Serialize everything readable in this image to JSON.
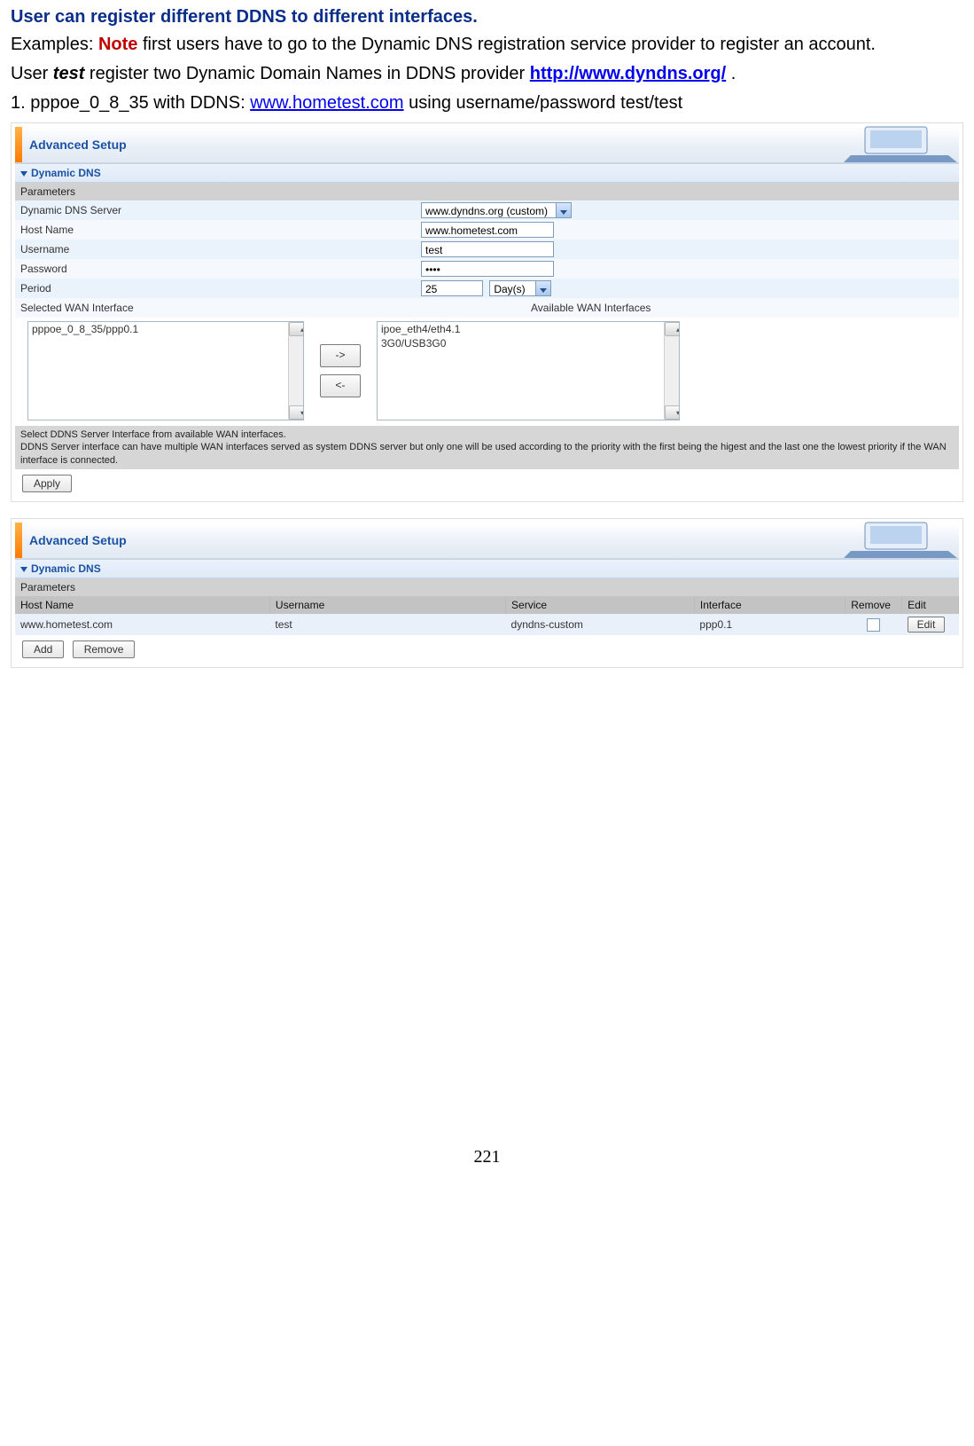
{
  "doc": {
    "heading": "User can register different DDNS to different interfaces.",
    "examples_prefix": "Examples: ",
    "note_label": "Note",
    "examples_rest": " first users have to go to the Dynamic DNS registration service provider to register an account.",
    "line3a": "User ",
    "line3_user": "test",
    "line3b": " register two Dynamic Domain Names in DDNS provider ",
    "provider_url_text": "http://www.dyndns.org/",
    "line3c": " .",
    "line4a": "1. pppoe_0_8_35 with DDNS: ",
    "ddns_link_text": "www.hometest.com",
    "line4b": " using username/password test/test",
    "page_number": "221"
  },
  "shot1": {
    "header_title": "Advanced Setup",
    "section_title": "Dynamic DNS",
    "params_label": "Parameters",
    "rows": {
      "ddns_server_label": "Dynamic DNS Server",
      "ddns_server_value": "www.dyndns.org (custom)",
      "hostname_label": "Host Name",
      "hostname_value": "www.hometest.com",
      "username_label": "Username",
      "username_value": "test",
      "password_label": "Password",
      "password_value": "••••",
      "period_label": "Period",
      "period_value": "25",
      "period_unit": "Day(s)",
      "selected_label": "Selected WAN Interface",
      "available_label": "Available WAN Interfaces"
    },
    "selected_list": [
      "pppoe_0_8_35/ppp0.1"
    ],
    "available_list": [
      "ipoe_eth4/eth4.1",
      "3G0/USB3G0"
    ],
    "move_right": "->",
    "move_left": "<-",
    "help1": "Select DDNS Server Interface from available WAN interfaces.",
    "help2": "DDNS Server interface can have multiple WAN interfaces served as system DDNS server but only one will be used according to the priority with the first being the higest and the last one the lowest priority if the WAN interface is connected.",
    "apply_label": "Apply"
  },
  "shot2": {
    "header_title": "Advanced Setup",
    "section_title": "Dynamic DNS",
    "params_label": "Parameters",
    "columns": {
      "hostname": "Host Name",
      "username": "Username",
      "service": "Service",
      "interface": "Interface",
      "remove": "Remove",
      "edit": "Edit"
    },
    "row": {
      "hostname": "www.hometest.com",
      "username": "test",
      "service": "dyndns-custom",
      "interface": "ppp0.1",
      "edit_btn": "Edit"
    },
    "add_label": "Add",
    "remove_label": "Remove"
  }
}
